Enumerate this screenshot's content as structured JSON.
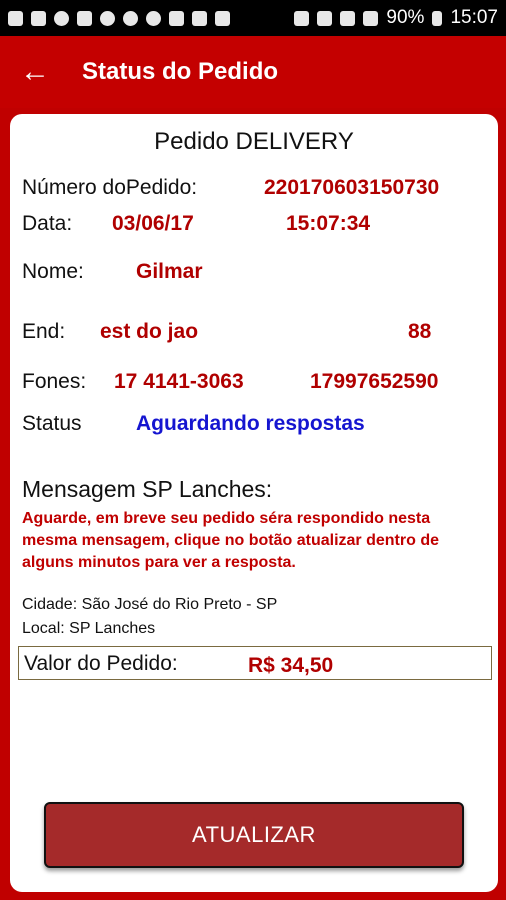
{
  "statusbar": {
    "battery": "90%",
    "time": "15:07"
  },
  "appbar": {
    "back_icon": "arrow-back-icon",
    "title": "Status do Pedido"
  },
  "order": {
    "heading": "Pedido DELIVERY",
    "numero_label": "Número doPedido:",
    "numero_value": "220170603150730",
    "data_label": "Data:",
    "data_date": "03/06/17",
    "data_time": "15:07:34",
    "nome_label": "Nome:",
    "nome_value": "Gilmar",
    "end_label": "End:",
    "end_value": "est do jao",
    "end_number": "88",
    "fones_label": "Fones:",
    "fone1": "17 4141-3063",
    "fone2": "17997652590",
    "status_label": "Status",
    "status_value": "Aguardando respostas"
  },
  "message": {
    "title": "Mensagem SP Lanches:",
    "body": "Aguarde, em breve seu pedido séra respondido nesta mesma mensagem, clique no botão atualizar dentro de alguns minutos para ver a resposta."
  },
  "info": {
    "cidade": "Cidade: São José do Rio Preto - SP",
    "local": "Local: SP Lanches",
    "valor_label": "Valor do Pedido:",
    "valor_value": "R$ 34,50"
  },
  "actions": {
    "update_label": "ATUALIZAR"
  },
  "colors": {
    "primary": "#c40000",
    "accent_text": "#b00000",
    "status_blue": "#1515d0",
    "button": "#a52a2a"
  }
}
